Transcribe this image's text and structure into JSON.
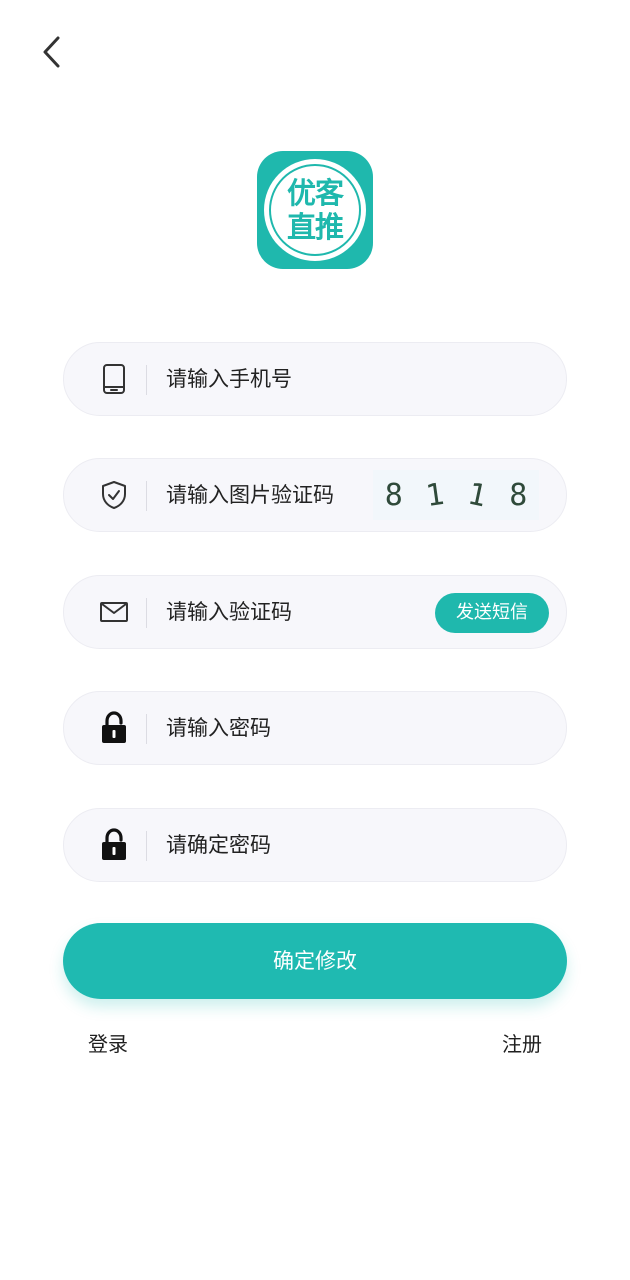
{
  "header": {
    "back_icon": "chevron-left-icon"
  },
  "logo": {
    "line1": "优客",
    "line2": "直推",
    "color": "#1fb8ad"
  },
  "form": {
    "phone": {
      "placeholder": "请输入手机号",
      "icon": "phone-icon"
    },
    "image_code": {
      "placeholder": "请输入图片验证码",
      "icon": "shield-check-icon",
      "captcha_chars": [
        "8",
        "1",
        "1",
        "8"
      ]
    },
    "sms_code": {
      "placeholder": "请输入验证码",
      "icon": "mail-icon",
      "send_label": "发送短信"
    },
    "password": {
      "placeholder": "请输入密码",
      "icon": "lock-icon"
    },
    "confirm_password": {
      "placeholder": "请确定密码",
      "icon": "lock-icon"
    },
    "submit_label": "确定修改"
  },
  "footer": {
    "login_label": "登录",
    "register_label": "注册"
  },
  "colors": {
    "accent": "#1fbab1",
    "field_background": "#f7f7fb"
  }
}
